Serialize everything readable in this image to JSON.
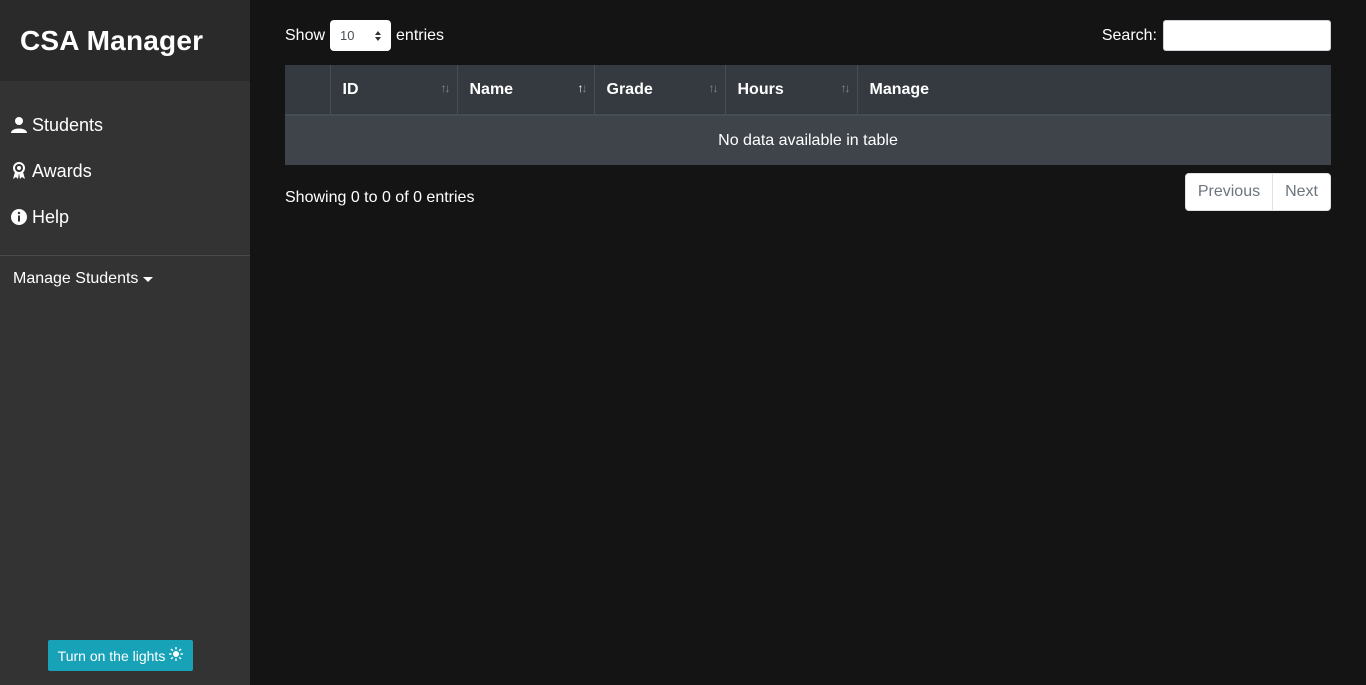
{
  "app": {
    "title": "CSA Manager"
  },
  "sidebar": {
    "items": [
      {
        "label": "Students",
        "icon": "user-icon"
      },
      {
        "label": "Awards",
        "icon": "award-icon"
      },
      {
        "label": "Help",
        "icon": "info-icon"
      }
    ],
    "manage_label": "Manage Students",
    "lights_label": "Turn on the lights",
    "lights_icon": "sun-icon"
  },
  "table_controls": {
    "show_label": "Show",
    "entries_value": "10",
    "entries_label": "entries",
    "search_label": "Search:",
    "search_value": ""
  },
  "table": {
    "columns": [
      "",
      "ID",
      "Name",
      "Grade",
      "Hours",
      "Manage"
    ],
    "empty_message": "No data available in table",
    "info": "Showing 0 to 0 of 0 entries",
    "pagination": {
      "previous": "Previous",
      "next": "Next"
    }
  },
  "colors": {
    "background": "#141414",
    "sidebar": "#333333",
    "brand": "#2a2a2a",
    "header": "#343a40",
    "row": "#3f444a",
    "accent": "#17a2b8"
  }
}
